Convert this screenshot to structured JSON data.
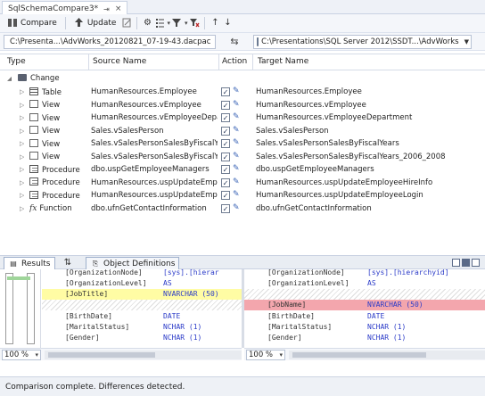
{
  "document_tab": {
    "title": "SqlSchemaCompare3*",
    "pin": "⇥",
    "close": "×"
  },
  "toolbar": {
    "compare_label": "Compare",
    "update_label": "Update"
  },
  "paths": {
    "source": "C:\\Presenta...\\AdvWorks_20120821_07-19-43.dacpac",
    "target": "C:\\Presentations\\SQL Server 2012\\SSDT...\\AdvWorks",
    "swap": "⇆"
  },
  "grid": {
    "columns": {
      "type": "Type",
      "source": "Source Name",
      "action": "Action",
      "target": "Target Name"
    },
    "group_label": "Change",
    "rows": [
      {
        "type": "Table",
        "icon": "table",
        "source": "HumanResources.Employee",
        "checked": "✓",
        "target": "HumanResources.Employee"
      },
      {
        "type": "View",
        "icon": "view",
        "source": "HumanResources.vEmployee",
        "checked": "✓",
        "target": "HumanResources.vEmployee"
      },
      {
        "type": "View",
        "icon": "view",
        "source": "HumanResources.vEmployeeDepart",
        "checked": "✓",
        "target": "HumanResources.vEmployeeDepartment"
      },
      {
        "type": "View",
        "icon": "view",
        "source": "Sales.vSalesPerson",
        "checked": "✓",
        "target": "Sales.vSalesPerson"
      },
      {
        "type": "View",
        "icon": "view",
        "source": "Sales.vSalesPersonSalesByFiscalYears",
        "checked": "✓",
        "target": "Sales.vSalesPersonSalesByFiscalYears"
      },
      {
        "type": "View",
        "icon": "view",
        "source": "Sales.vSalesPersonSalesByFiscalYear",
        "checked": "✓",
        "target": "Sales.vSalesPersonSalesByFiscalYears_2006_2008"
      },
      {
        "type": "Procedure",
        "icon": "proc",
        "source": "dbo.uspGetEmployeeManagers",
        "checked": "✓",
        "target": "dbo.uspGetEmployeeManagers"
      },
      {
        "type": "Procedure",
        "icon": "proc",
        "source": "HumanResources.uspUpdateEmploy",
        "checked": "✓",
        "target": "HumanResources.uspUpdateEmployeeHireInfo"
      },
      {
        "type": "Procedure",
        "icon": "proc",
        "source": "HumanResources.uspUpdateEmploy",
        "checked": "✓",
        "target": "HumanResources.uspUpdateEmployeeLogin"
      },
      {
        "type": "Function",
        "icon": "fx",
        "source": "dbo.ufnGetContactInformation",
        "checked": "✓",
        "target": "dbo.ufnGetContactInformation"
      }
    ]
  },
  "panel_tabs": {
    "results": "Results",
    "object_definitions": "Object Definitions"
  },
  "left_code": [
    {
      "name": "[OrganizationNode]",
      "type": "[sys].[hierar",
      "style": "cut"
    },
    {
      "name": "[OrganizationLevel]",
      "type": "AS",
      "style": "plain"
    },
    {
      "name": "[JobTitle]",
      "type": "NVARCHAR (50)",
      "style": "added"
    },
    {
      "name": "",
      "type": "",
      "style": "hatch"
    },
    {
      "name": "[BirthDate]",
      "type": "DATE",
      "style": "plain"
    },
    {
      "name": "[MaritalStatus]",
      "type": "NCHAR (1)",
      "style": "plain"
    },
    {
      "name": "[Gender]",
      "type": "NCHAR (1)",
      "style": "plain"
    }
  ],
  "right_code": [
    {
      "name": "[OrganizationNode]",
      "type": "[sys].[hierarchyid]",
      "style": "cut"
    },
    {
      "name": "[OrganizationLevel]",
      "type": "AS",
      "style": "plain"
    },
    {
      "name": "",
      "type": "",
      "style": "hatch"
    },
    {
      "name": "[JobName]",
      "type": "NVARCHAR (50)",
      "style": "removed"
    },
    {
      "name": "[BirthDate]",
      "type": "DATE",
      "style": "plain"
    },
    {
      "name": "[MaritalStatus]",
      "type": "NCHAR (1)",
      "style": "plain"
    },
    {
      "name": "[Gender]",
      "type": "NCHAR (1)",
      "style": "plain"
    }
  ],
  "zoom": {
    "left": "100 %",
    "right": "100 %"
  },
  "status": "Comparison complete.  Differences detected."
}
